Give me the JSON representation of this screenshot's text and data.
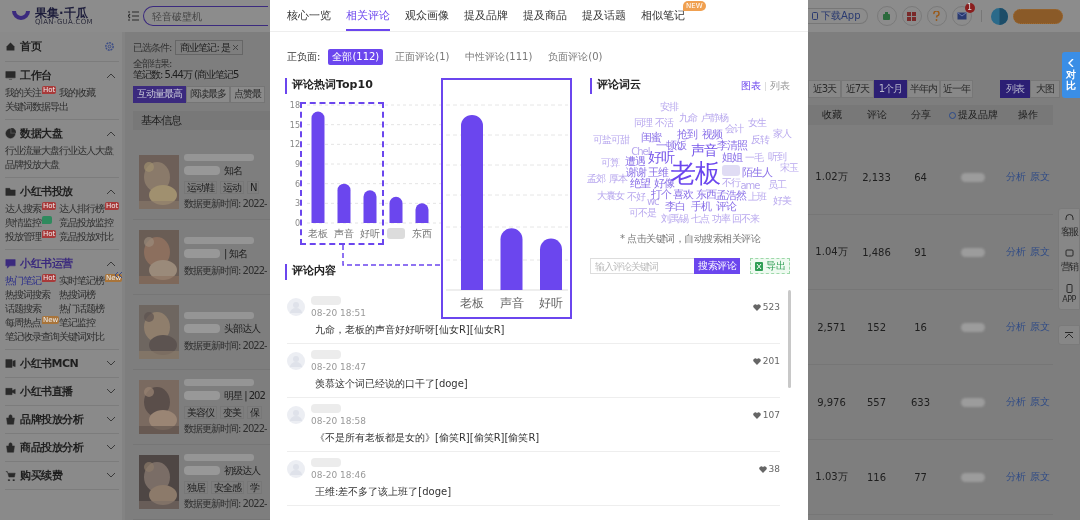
{
  "header": {
    "logo": {
      "name": "果集·千瓜",
      "domain": "QIAN-GUA.COM"
    },
    "search": {
      "placeholder": "轻音破壁机"
    },
    "download_button": "下载App",
    "notification_badge": "1"
  },
  "sidebar": {
    "home": {
      "label": "首页"
    },
    "sections": [
      {
        "title": "工作台",
        "expanded": true,
        "active": false,
        "items": [
          {
            "label": "我的关注",
            "selected": false,
            "badge": {
              "text": "Hot",
              "color": "#a83a3a"
            }
          },
          {
            "label": "我的收藏",
            "selected": false
          },
          {
            "label": "关键词数据导出",
            "selected": false
          }
        ]
      },
      {
        "title": "数据大盘",
        "expanded": true,
        "active": false,
        "items": [
          {
            "label": "行业流量大盘",
            "selected": false
          },
          {
            "label": "行业达人大盘",
            "selected": false
          },
          {
            "label": "品牌投放大盘",
            "selected": false
          }
        ]
      },
      {
        "title": "小红书投放",
        "expanded": true,
        "active": false,
        "items": [
          {
            "label": "达人搜索",
            "selected": false,
            "badge": {
              "text": "Hot",
              "color": "#a83a3a"
            }
          },
          {
            "label": "达人排行榜",
            "selected": false,
            "badge": {
              "text": "Hot",
              "color": "#a83a3a"
            }
          },
          {
            "label": "舆情监控",
            "selected": false,
            "badge": {
              "color": "#2f8a5e"
            }
          },
          {
            "label": "竞品投放监控",
            "selected": false
          },
          {
            "label": "投放管理",
            "selected": false,
            "badge": {
              "text": "Hot",
              "color": "#a83a3a"
            }
          },
          {
            "label": "竞品投放对比",
            "selected": false
          }
        ]
      },
      {
        "title": "小红书运营",
        "expanded": true,
        "active": true,
        "items": [
          {
            "label": "热门笔记",
            "selected": true,
            "badge": {
              "text": "Hot",
              "color": "#a83a3a"
            }
          },
          {
            "label": "实时笔记榜",
            "selected": false,
            "badge": {
              "text": "New",
              "color": "#a8743a"
            }
          },
          {
            "label": "热搜词搜索",
            "selected": false
          },
          {
            "label": "热搜词榜",
            "selected": false
          },
          {
            "label": "话题搜索",
            "selected": false
          },
          {
            "label": "热门话题榜",
            "selected": false
          },
          {
            "label": "每周热点",
            "selected": false,
            "badge": {
              "text": "New",
              "color": "#a8743a"
            }
          },
          {
            "label": "笔记监控",
            "selected": false
          },
          {
            "label": "笔记收录查询",
            "selected": false
          },
          {
            "label": "关键词对比",
            "selected": false
          }
        ]
      },
      {
        "title": "小红书MCN",
        "expanded": false,
        "active": false
      },
      {
        "title": "小红书直播",
        "expanded": false,
        "active": false
      },
      {
        "title": "品牌投放分析",
        "expanded": false,
        "active": false
      },
      {
        "title": "商品投放分析",
        "expanded": false,
        "active": false
      },
      {
        "title": "购买续费",
        "expanded": false,
        "active": false
      }
    ]
  },
  "page": {
    "filter_label": "已选条件:",
    "filter_chip": "商业笔记: 是",
    "result_label": "全部结果:",
    "result_text": "笔记数: 5.44万 (商业笔记5",
    "sort_tabs": [
      {
        "label": "互动量最高",
        "selected": true
      },
      {
        "label": "阅读最多",
        "selected": false
      },
      {
        "label": "点赞最",
        "selected": false
      }
    ],
    "time_tabs": [
      {
        "label": "近3天",
        "selected": false
      },
      {
        "label": "近7天",
        "selected": false
      },
      {
        "label": "1个月",
        "selected": true
      },
      {
        "label": "半年内",
        "selected": false
      },
      {
        "label": "近一年",
        "selected": false
      }
    ],
    "view_tabs": [
      {
        "label": "列表",
        "selected": true
      },
      {
        "label": "大图",
        "selected": false
      }
    ],
    "columns": {
      "basic": "基本信息",
      "favorites": "收藏",
      "comments": "评论",
      "shares": "分享",
      "brands": "提及品牌",
      "actions": "操作"
    },
    "rows": [
      {
        "label": "知名",
        "tags": [
          "运动鞋",
          "运动",
          "N"
        ],
        "updated": "数据更新时间: 2022-",
        "favorites": "1.02万",
        "comments": "2,133",
        "shares": "64",
        "actions": [
          "分析",
          "原文"
        ]
      },
      {
        "label": "| 知名",
        "updated": "数据更新时间: 2022-",
        "favorites": "1.04万",
        "comments": "1,486",
        "shares": "91",
        "actions": [
          "分析",
          "原文"
        ]
      },
      {
        "label": "头部达人",
        "updated": "数据更新时间: 2022-",
        "favorites": "2,571",
        "comments": "152",
        "shares": "16",
        "actions": [
          "分析",
          "原文"
        ]
      },
      {
        "label": "明星 | 202",
        "tags": [
          "美容仪",
          "变美",
          "保"
        ],
        "updated": "数据更新时间: 2022-",
        "favorites": "9,976",
        "comments": "557",
        "shares": "633",
        "actions": [
          "分析",
          "原文"
        ]
      },
      {
        "label": "初级达人",
        "tags": [
          "独居",
          "安全感",
          "学"
        ],
        "updated": "数据更新时间: 2022-",
        "favorites": "1.03万",
        "comments": "116",
        "shares": "77",
        "actions": [
          "分析",
          "原文"
        ]
      }
    ]
  },
  "modal": {
    "tabs": [
      {
        "label": "核心一览",
        "selected": false
      },
      {
        "label": "相关评论",
        "selected": true
      },
      {
        "label": "观众画像",
        "selected": false
      },
      {
        "label": "提及品牌",
        "selected": false
      },
      {
        "label": "提及商品",
        "selected": false
      },
      {
        "label": "提及话题",
        "selected": false
      },
      {
        "label": "相似笔记",
        "selected": false,
        "badge": "NEW"
      }
    ],
    "sentiment_label": "正负面:",
    "sentiment_filters": [
      {
        "label": "全部(112)",
        "selected": true
      },
      {
        "label": "正面评论(1)",
        "selected": false
      },
      {
        "label": "中性评论(111)",
        "selected": false
      },
      {
        "label": "负面评论(0)",
        "selected": false
      }
    ],
    "hot_words": {
      "title": "评论热词Top10",
      "chart_data": {
        "type": "bar",
        "categories": [
          "老板",
          "声音",
          "好听",
          null,
          "东西"
        ],
        "series": [
          {
            "color": "#6b46ee",
            "values": [
              17,
              6,
              5,
              4,
              3
            ]
          }
        ],
        "ylim": [
          0,
          18
        ],
        "yticks": [
          0,
          3,
          6,
          9,
          12,
          15,
          18
        ],
        "grid": true
      },
      "zoom_inset": {
        "categories": [
          "老板",
          "声音",
          "好听"
        ]
      }
    },
    "word_cloud": {
      "title": "评论词云",
      "views": [
        {
          "label": "图表",
          "selected": true
        },
        {
          "label": "列表",
          "selected": false
        }
      ],
      "words": [
        "安排",
        "同理",
        "不活",
        "九命",
        "卢静杨",
        "会计",
        "女生",
        "可盐可甜",
        "闺蜜",
        "抢到",
        "视频",
        "反转",
        "家人",
        "一顿饭",
        "Chel",
        "声音",
        "李清照",
        "可算",
        "遭遇",
        "好听",
        "姐姐",
        "一毛",
        "听到",
        "谢谢",
        "王维",
        "老板",
        "陌生人",
        "宋玉",
        "孟郊",
        "厚本",
        "绝望",
        "好像",
        "不行",
        "ame",
        "员工",
        "大囊女",
        "不好",
        "打个",
        "喜欢",
        "东西",
        "孟浩然",
        "上班",
        "wc",
        "李白",
        "手机",
        "评论",
        "好美",
        "可不是",
        "刘禹锡",
        "七点",
        "功率",
        "回不来"
      ],
      "note": "* 点击关键词，自动搜索相关评论",
      "search_placeholder": "输入评论关键词",
      "search_button": "搜索评论",
      "export_button": "导出"
    },
    "comments_title": "评论内容",
    "comments": [
      {
        "date": "08-20 18:51",
        "likes": "523",
        "text": "九命，老板的声音好好听呀[仙女R][仙女R]"
      },
      {
        "date": "08-20 18:47",
        "likes": "201",
        "text": "羡慕这个词已经说的口干了[doge]"
      },
      {
        "date": "08-20 18:58",
        "likes": "107",
        "text": "《不是所有老板都是女的》[偷笑R][偷笑R][偷笑R]"
      },
      {
        "date": "08-20 18:46",
        "likes": "38",
        "text": "王维:差不多了该上班了[doge]"
      }
    ]
  },
  "float": {
    "compare": "对比",
    "tools": [
      "客服",
      "营销",
      "APP"
    ]
  }
}
